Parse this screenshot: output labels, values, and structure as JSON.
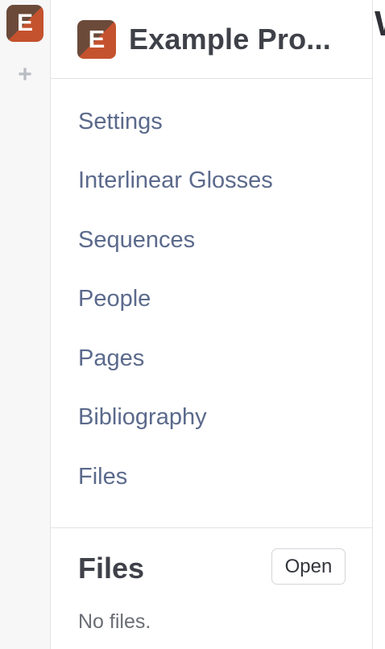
{
  "rail": {
    "avatar_letter": "E",
    "add_symbol": "+"
  },
  "project": {
    "avatar_letter": "E",
    "title": "Example Pro..."
  },
  "nav": {
    "items": [
      {
        "label": "Settings"
      },
      {
        "label": "Interlinear Glosses"
      },
      {
        "label": "Sequences"
      },
      {
        "label": "People"
      },
      {
        "label": "Pages"
      },
      {
        "label": "Bibliography"
      },
      {
        "label": "Files"
      }
    ]
  },
  "files_panel": {
    "title": "Files",
    "open_label": "Open",
    "empty_text": "No files."
  },
  "main": {
    "heading_fragment": "W"
  },
  "colors": {
    "avatar_dark": "#6b4a3a",
    "avatar_accent": "#c4522e",
    "nav_link": "#5b6a8c",
    "heading": "#3f4149"
  }
}
